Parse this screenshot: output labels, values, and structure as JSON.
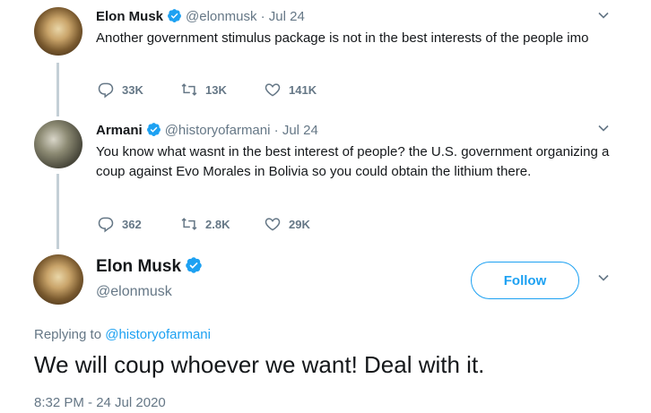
{
  "tweets": [
    {
      "name": "Elon Musk",
      "handle": "@elonmusk",
      "separator": "·",
      "date": "Jul 24",
      "text": "Another government stimulus package is not in the best interests of the people imo",
      "replies": "33K",
      "retweets": "13K",
      "likes": "141K"
    },
    {
      "name": "Armani",
      "handle": "@historyofarmani",
      "separator": "·",
      "date": "Jul 24",
      "text": "You know what wasnt in the best interest of people? the U.S. government organizing a coup against Evo Morales in Bolivia so you could obtain the lithium there.",
      "replies": "362",
      "retweets": "2.8K",
      "likes": "29K"
    }
  ],
  "main_tweet": {
    "name": "Elon Musk",
    "handle": "@elonmusk",
    "follow_label": "Follow",
    "replying_prefix": "Replying to",
    "replying_to": "@historyofarmani",
    "text": "We will coup whoever we want! Deal with it.",
    "timestamp": "8:32 PM - 24 Jul 2020"
  },
  "icons": {
    "reply": "reply-icon",
    "retweet": "retweet-icon",
    "like": "heart-icon",
    "verified": "verified-badge-icon",
    "more": "chevron-down-icon"
  },
  "colors": {
    "brand": "#1da1f2",
    "muted": "#657786",
    "text": "#14171a",
    "thread_line": "#c4cfd6"
  }
}
